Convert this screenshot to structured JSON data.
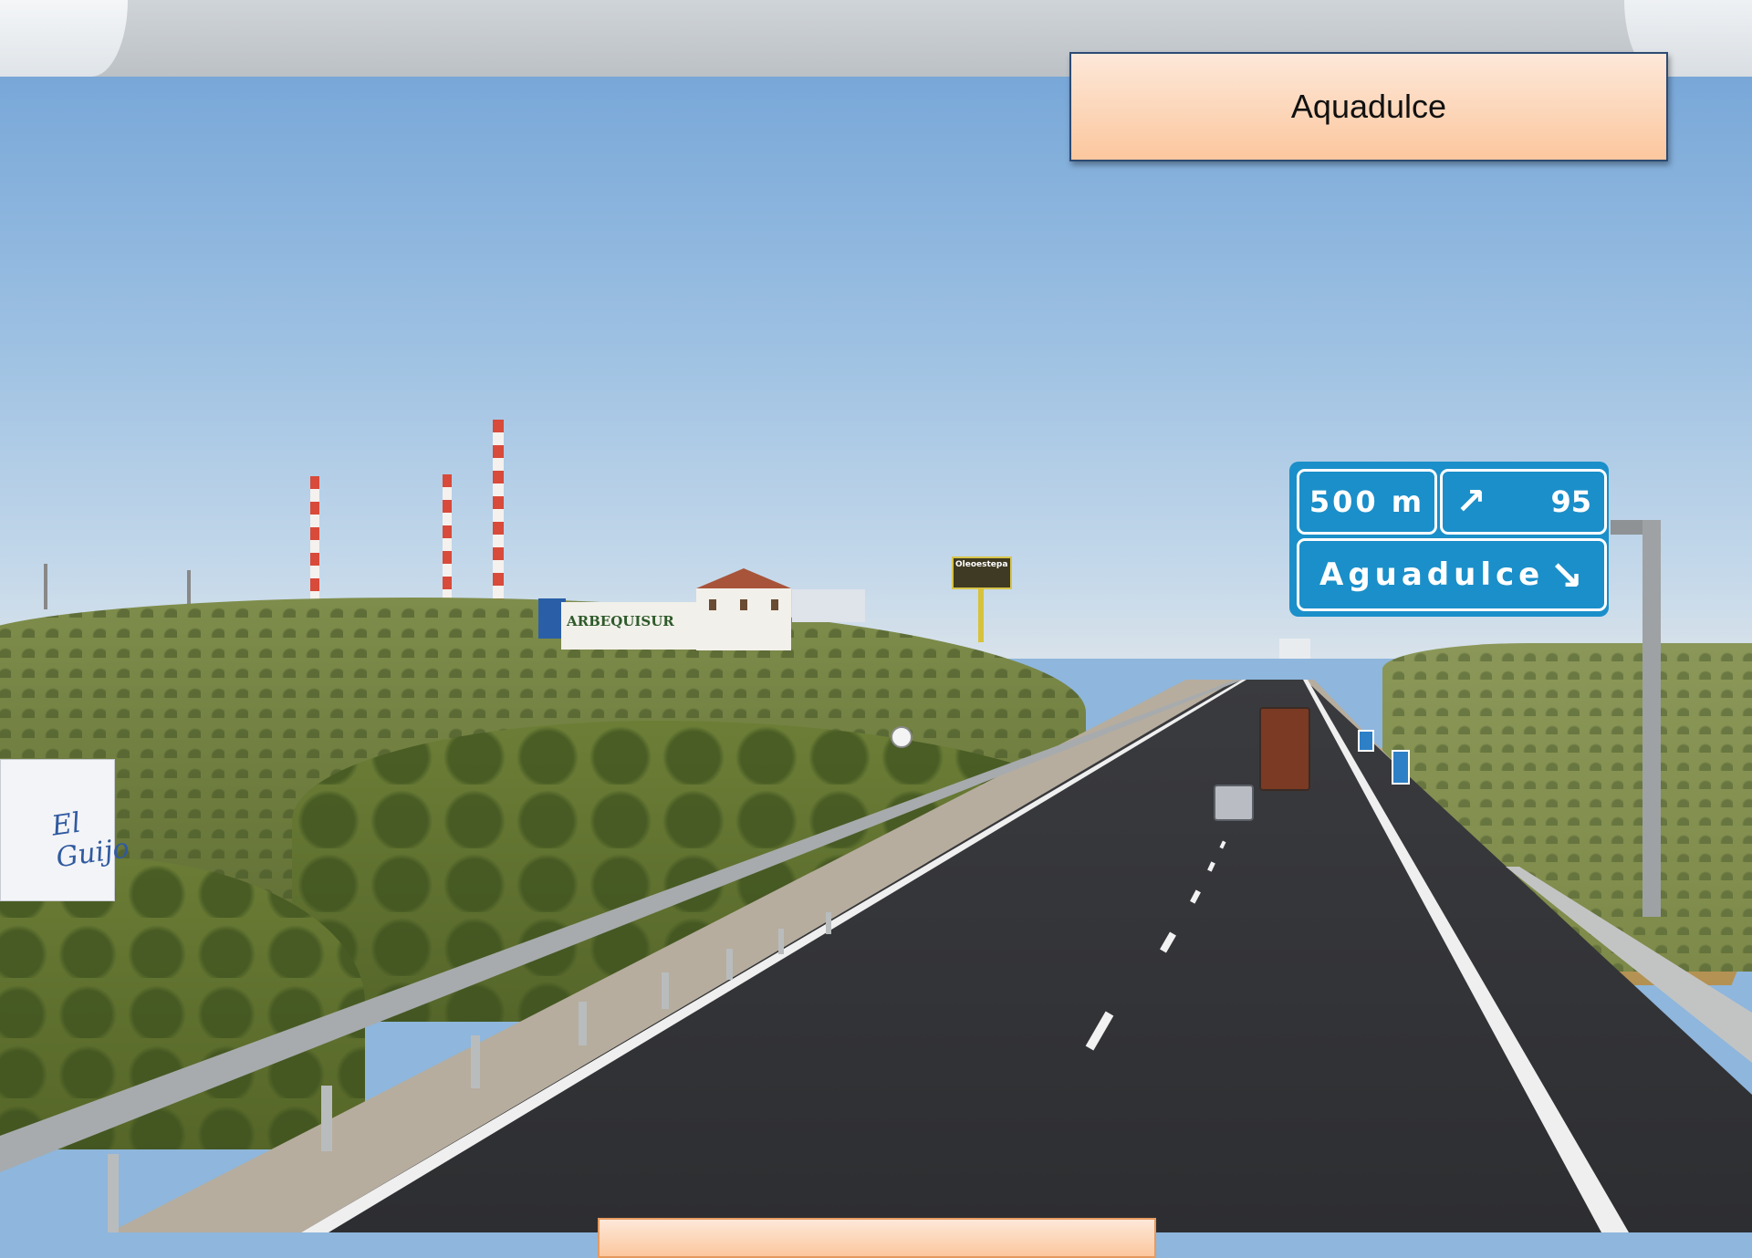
{
  "caption": {
    "label": "Aquadulce"
  },
  "road_sign": {
    "distance": "500 m",
    "exit_number": "95",
    "destination": "Aguadulce",
    "exit_icon": "exit-ramp-icon",
    "arrow_icon": "arrow-down-right-icon",
    "color": "#1b8fc9"
  },
  "building_sign": {
    "text": "ARBEQUISUR"
  },
  "truck": {
    "brand": "El Guijo"
  },
  "billboard": {
    "text": "Oleoestepa"
  },
  "colors": {
    "caption_fill": "#fcc79e",
    "caption_border": "#2d4a73",
    "sky": "#9cc0e2"
  }
}
